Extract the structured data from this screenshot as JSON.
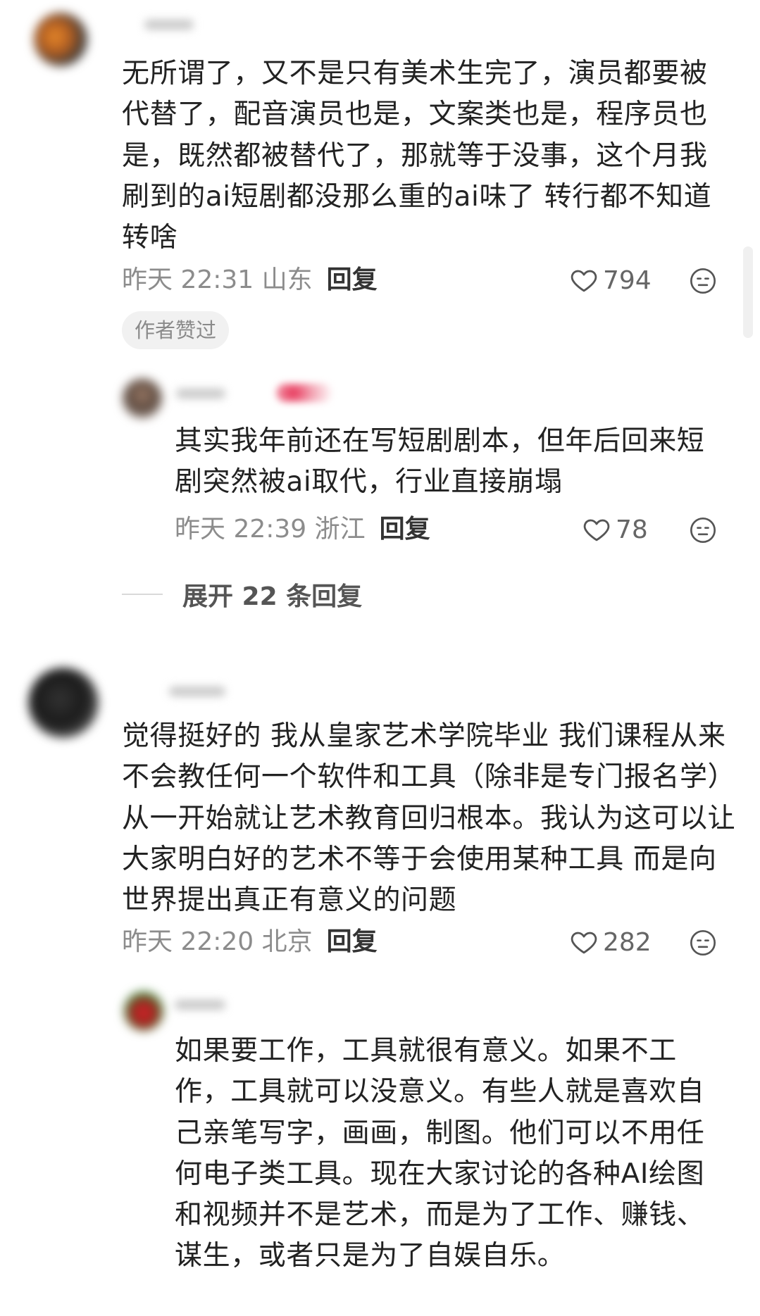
{
  "comments": [
    {
      "text": "无所谓了，又不是只有美术生完了，演员都要被代替了，配音演员也是，文案类也是，程序员也是，既然都被替代了，那就等于没事，这个月我刷到的ai短剧都没那么重的ai味了 转行都不知道转啥",
      "time_loc": "昨天 22:31 山东",
      "reply_label": "回复",
      "likes": "794",
      "badge": "作者赞过",
      "replies": [
        {
          "text": "其实我年前还在写短剧剧本，但年后回来短剧突然被ai取代，行业直接崩塌",
          "time_loc": "昨天 22:39 浙江",
          "reply_label": "回复",
          "likes": "78"
        }
      ],
      "expand_label": "展开 22 条回复"
    },
    {
      "text": "觉得挺好的 我从皇家艺术学院毕业 我们课程从来不会教任何一个软件和工具（除非是专门报名学）从一开始就让艺术教育回归根本。我认为这可以让大家明白好的艺术不等于会使用某种工具 而是向世界提出真正有意义的问题",
      "time_loc": "昨天 22:20 北京",
      "reply_label": "回复",
      "likes": "282",
      "replies": [
        {
          "text": "如果要工作，工具就很有意义。如果不工作，工具就可以没意义。有些人就是喜欢自己亲笔写字，画画，制图。他们可以不用任何电子类工具。现在大家讨论的各种AI绘图和视频并不是艺术，而是为了工作、赚钱、谋生，或者只是为了自娱自乐。"
        }
      ]
    }
  ],
  "icons": {
    "like": "heart-outline-icon",
    "emoji": "neutral-face-icon"
  },
  "colors": {
    "text": "#222222",
    "meta": "#8c8c8c",
    "badge_bg": "#f1f1f1"
  }
}
